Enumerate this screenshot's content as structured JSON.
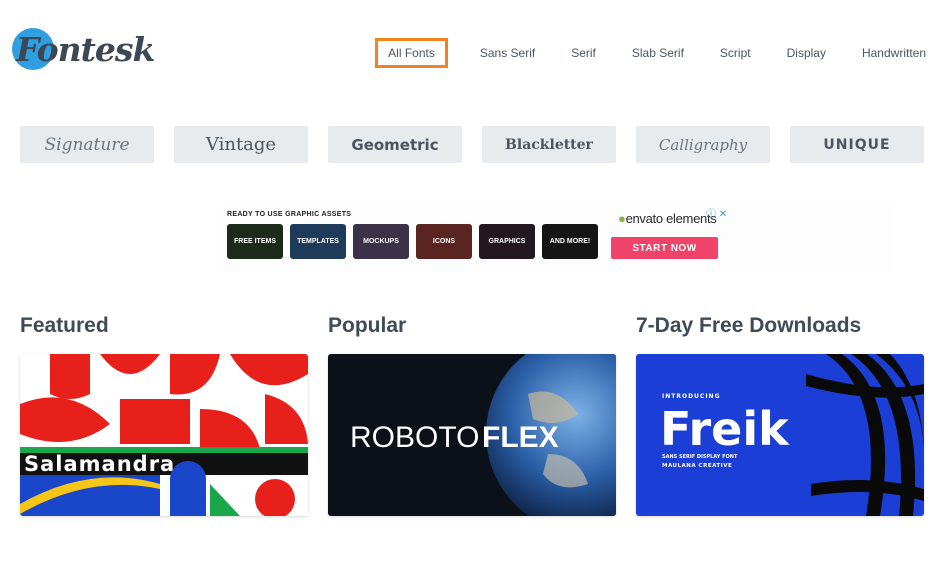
{
  "header": {
    "logo_text": "Fontesk",
    "nav": [
      {
        "label": "All Fonts",
        "active": true
      },
      {
        "label": "Sans Serif"
      },
      {
        "label": "Serif"
      },
      {
        "label": "Slab Serif"
      },
      {
        "label": "Script"
      },
      {
        "label": "Display"
      },
      {
        "label": "Handwritten"
      }
    ]
  },
  "categories": [
    "Signature",
    "Vintage",
    "Geometric",
    "Blackletter",
    "Calligraphy",
    "UNIQUE"
  ],
  "ad": {
    "tagline": "READY TO USE GRAPHIC ASSETS",
    "tiles": [
      {
        "label": "FREE ITEMS",
        "color": "#1e2a1c"
      },
      {
        "label": "TEMPLATES",
        "color": "#1f3b5a"
      },
      {
        "label": "MOCKUPS",
        "color": "#3b3148"
      },
      {
        "label": "ICONS",
        "color": "#5a2420"
      },
      {
        "label": "GRAPHICS",
        "color": "#241820"
      },
      {
        "label": "AND MORE!",
        "color": "#151515"
      }
    ],
    "brand": "envato elements",
    "brand_leaf": "●",
    "close": "ⓘ ✕",
    "cta": "START NOW"
  },
  "sections": [
    {
      "title": "Featured",
      "card_text": "Salamandra"
    },
    {
      "title": "Popular",
      "card_text_light": "ROBOTO",
      "card_text_bold": "FLEX"
    },
    {
      "title": "7-Day Free Downloads",
      "card_kicker": "INTRODUCING",
      "card_text": "Freik",
      "card_sub1": "SANS SERIF DISPLAY FONT",
      "card_sub2": "MAULANA CREATIVE"
    }
  ],
  "colors": {
    "accent": "#f58220",
    "brand_blue": "#2f9fe2",
    "cta": "#f0436a"
  }
}
